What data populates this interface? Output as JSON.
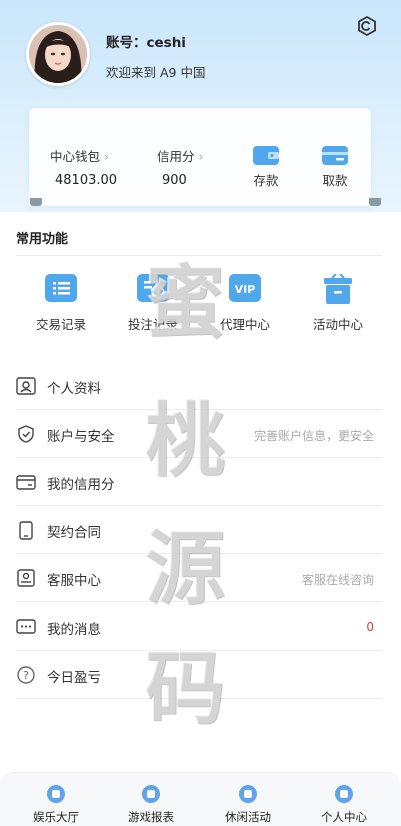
{
  "profile": {
    "account": "账号：ceshi",
    "welcome": "欢迎来到 A9 中国"
  },
  "wallet": {
    "center_label": "中心钱包",
    "center_value": "48103.00",
    "credit_label": "信用分",
    "credit_value": "900",
    "deposit_label": "存款",
    "withdraw_label": "取款"
  },
  "common": {
    "title": "常用功能",
    "items": [
      {
        "label": "交易记录",
        "icon": "list-icon"
      },
      {
        "label": "投注记录",
        "icon": "bet-record-icon"
      },
      {
        "label": "代理中心",
        "icon": "vip-icon"
      },
      {
        "label": "活动中心",
        "icon": "gift-icon"
      }
    ]
  },
  "menu": [
    {
      "label": "个人资料",
      "right": "",
      "icon": "profile-icon"
    },
    {
      "label": "账户与安全",
      "right": "完善账户信息，更安全",
      "icon": "shield-icon"
    },
    {
      "label": "我的信用分",
      "right": "",
      "icon": "card-icon"
    },
    {
      "label": "契约合同",
      "right": "",
      "icon": "phone-icon"
    },
    {
      "label": "客服中心",
      "right": "客服在线咨询",
      "icon": "service-icon"
    },
    {
      "label": "我的消息",
      "right": "0",
      "icon": "message-icon"
    },
    {
      "label": "今日盈亏",
      "right": "",
      "icon": "question-icon"
    }
  ],
  "tabs": [
    {
      "label": "娱乐大厅",
      "icon": "home-icon"
    },
    {
      "label": "游戏报表",
      "icon": "report-icon"
    },
    {
      "label": "休闲活动",
      "icon": "activity-icon"
    },
    {
      "label": "个人中心",
      "icon": "user-icon"
    }
  ],
  "watermark": [
    "蜜",
    "桃",
    "源",
    "码"
  ],
  "colors": {
    "accent": "#4fa7ec",
    "header_bg": "#d3ebfc",
    "badge_red": "#e23b3b"
  }
}
